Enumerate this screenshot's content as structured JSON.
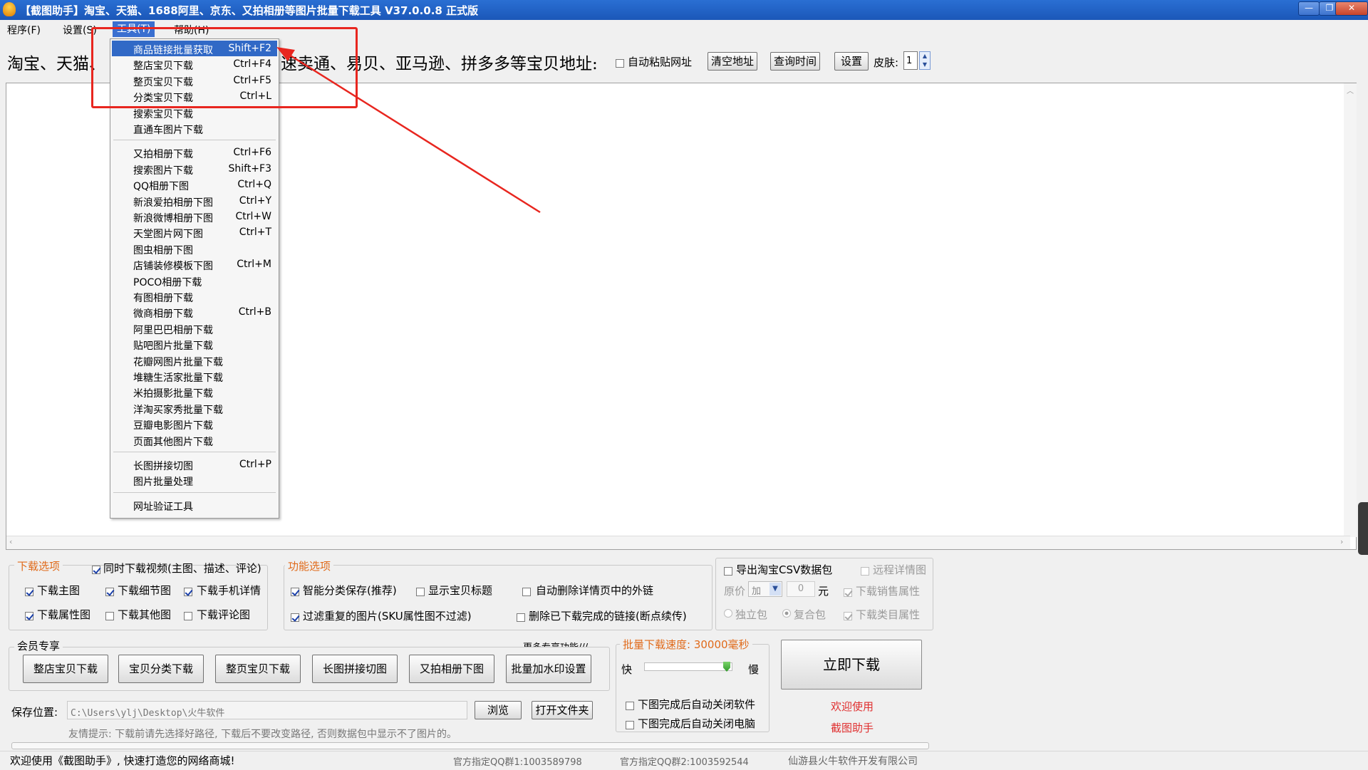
{
  "window": {
    "title": "【截图助手】淘宝、天猫、1688阿里、京东、又拍相册等图片批量下载工具 V37.0.0.8 正式版",
    "buttons": {
      "minimize": "—",
      "restore": "❐",
      "close": "✕"
    }
  },
  "menubar": {
    "items": [
      "程序(F)",
      "设置(S)",
      "工具(T)",
      "帮助(H)"
    ]
  },
  "address_row": {
    "label_left": "淘宝、天猫、",
    "label_right": "速卖通、易贝、亚马逊、拼多多等宝贝地址:",
    "auto_paste": "自动粘贴网址",
    "clear_btn": "清空地址",
    "query_btn": "查询时间",
    "settings_btn": "设置",
    "skin_label": "皮肤:",
    "skin_value": "1"
  },
  "tools_menu": {
    "items": [
      {
        "label": "商品链接批量获取",
        "shortcut": "Shift+F2"
      },
      {
        "label": "整店宝贝下载",
        "shortcut": "Ctrl+F4"
      },
      {
        "label": "整页宝贝下载",
        "shortcut": "Ctrl+F5"
      },
      {
        "label": "分类宝贝下载",
        "shortcut": "Ctrl+L"
      },
      {
        "label": "搜索宝贝下载",
        "shortcut": ""
      },
      {
        "label": "直通车图片下载",
        "shortcut": ""
      },
      {
        "label": "又拍相册下载",
        "shortcut": "Ctrl+F6"
      },
      {
        "label": "搜索图片下载",
        "shortcut": "Shift+F3"
      },
      {
        "label": "QQ相册下图",
        "shortcut": "Ctrl+Q"
      },
      {
        "label": "新浪爱拍相册下图",
        "shortcut": "Ctrl+Y"
      },
      {
        "label": "新浪微博相册下图",
        "shortcut": "Ctrl+W"
      },
      {
        "label": "天堂图片网下图",
        "shortcut": "Ctrl+T"
      },
      {
        "label": "图虫相册下图",
        "shortcut": ""
      },
      {
        "label": "店铺装修模板下图",
        "shortcut": "Ctrl+M"
      },
      {
        "label": "POCO相册下载",
        "shortcut": ""
      },
      {
        "label": "有图相册下载",
        "shortcut": ""
      },
      {
        "label": "微商相册下载",
        "shortcut": "Ctrl+B"
      },
      {
        "label": "阿里巴巴相册下载",
        "shortcut": ""
      },
      {
        "label": "贴吧图片批量下载",
        "shortcut": ""
      },
      {
        "label": "花瓣网图片批量下载",
        "shortcut": ""
      },
      {
        "label": "堆糖生活家批量下载",
        "shortcut": ""
      },
      {
        "label": "米拍摄影批量下载",
        "shortcut": ""
      },
      {
        "label": "洋淘买家秀批量下载",
        "shortcut": ""
      },
      {
        "label": "豆瓣电影图片下载",
        "shortcut": ""
      },
      {
        "label": "页面其他图片下载",
        "shortcut": ""
      },
      {
        "label": "长图拼接切图",
        "shortcut": "Ctrl+P"
      },
      {
        "label": "图片批量处理",
        "shortcut": ""
      },
      {
        "label": "网址验证工具",
        "shortcut": ""
      }
    ]
  },
  "download_options": {
    "title": "下载选项",
    "video": "同时下载视频(主图、描述、评论)",
    "main_img": "下载主图",
    "detail_img": "下载细节图",
    "mobile_detail": "下载手机详情",
    "attr_img": "下载属性图",
    "other_img": "下载其他图",
    "review_img": "下载评论图"
  },
  "function_options": {
    "title": "功能选项",
    "smart_save": "智能分类保存(推荐)",
    "show_title": "显示宝贝标题",
    "auto_delete_links": "自动删除详情页中的外链",
    "filter_dup": "过滤重复的图片(SKU属性图不过滤)",
    "delete_done_links": "删除已下载完成的链接(断点续传)"
  },
  "csv_options": {
    "export_csv": "导出淘宝CSV数据包",
    "remote_detail": "远程详情图",
    "price_label": "原价",
    "price_op": "加",
    "price_value": "0",
    "price_unit": "元",
    "sales_attr": "下载销售属性",
    "independent": "独立包",
    "composite": "复合包",
    "category_attr": "下载类目属性"
  },
  "member": {
    "title": "会员专享",
    "more": "更多专享功能///",
    "buttons": [
      "整店宝贝下载",
      "宝贝分类下载",
      "整页宝贝下载",
      "长图拼接切图",
      "又拍相册下图",
      "批量加水印设置"
    ]
  },
  "speed": {
    "title": "批量下载速度: 30000毫秒",
    "fast": "快",
    "slow": "慢",
    "slider_fraction": 0.98,
    "auto_close_app": "下图完成后自动关闭软件",
    "auto_shutdown": "下图完成后自动关闭电脑"
  },
  "download_now": "立即下载",
  "welcome": {
    "line1": "欢迎使用",
    "line2": "截图助手"
  },
  "save": {
    "label": "保存位置:",
    "path": "C:\\Users\\ylj\\Desktop\\火牛软件",
    "browse": "浏览",
    "open_folder": "打开文件夹",
    "tip": "友情提示: 下载前请先选择好路径, 下载后不要改变路径, 否则数据包中显示不了图片的。"
  },
  "statusbar": {
    "welcome": "欢迎使用《截图助手》, 快速打造您的网络商城!",
    "qq1": "官方指定QQ群1:1003589798",
    "qq2": "官方指定QQ群2:1003592544",
    "company": "仙游县火牛软件开发有限公司"
  },
  "colors": {
    "accent_red": "#e8261f",
    "menu_highlight": "#3169c6",
    "title_blue": "#1b57b8"
  }
}
